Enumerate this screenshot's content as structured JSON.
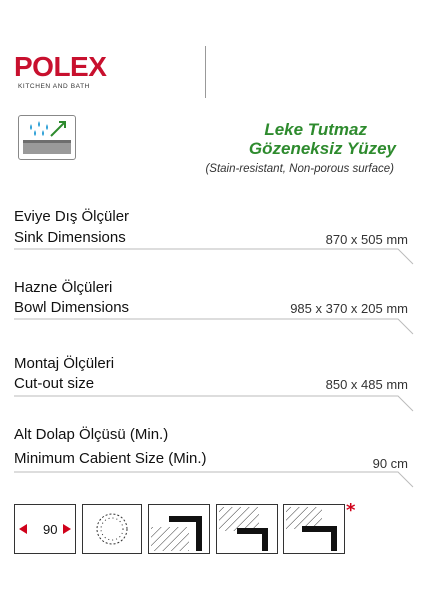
{
  "brand": {
    "name": "POLEX",
    "tagline": "KITCHEN AND BATH"
  },
  "feature": {
    "icon": "stain-resistant-surface-icon",
    "title_line1": "Leke Tutmaz",
    "title_line2": "Gözeneksiz Yüzey",
    "subtitle": "(Stain-resistant, Non-porous surface)",
    "accent_color": "#2e8b2e"
  },
  "specs": [
    {
      "label_tr": "Eviye Dış Ölçüler",
      "label_en": "Sink Dimensions",
      "value": "870 x 505 mm"
    },
    {
      "label_tr": "Hazne Ölçüleri",
      "label_en": "Bowl Dimensions",
      "value": "985 x 370 x 205 mm"
    },
    {
      "label_tr": "Montaj Ölçüleri",
      "label_en": "Cut-out size",
      "value": "850  x 485 mm"
    },
    {
      "label_tr": "Alt Dolap Ölçüsü (Min.)",
      "label_en": "Minimum Cabient Size (Min.)",
      "value": "90 cm"
    }
  ],
  "bottom_icons": {
    "angle_value": "90",
    "items": [
      "cabinet-angle-icon",
      "drain-hole-icon",
      "flush-mount-icon",
      "top-mount-icon",
      "corner-mount-icon",
      "undermount-icon"
    ],
    "note_mark": "*",
    "arrow_color": "#d0021b"
  },
  "brand_color": "#c8102e"
}
